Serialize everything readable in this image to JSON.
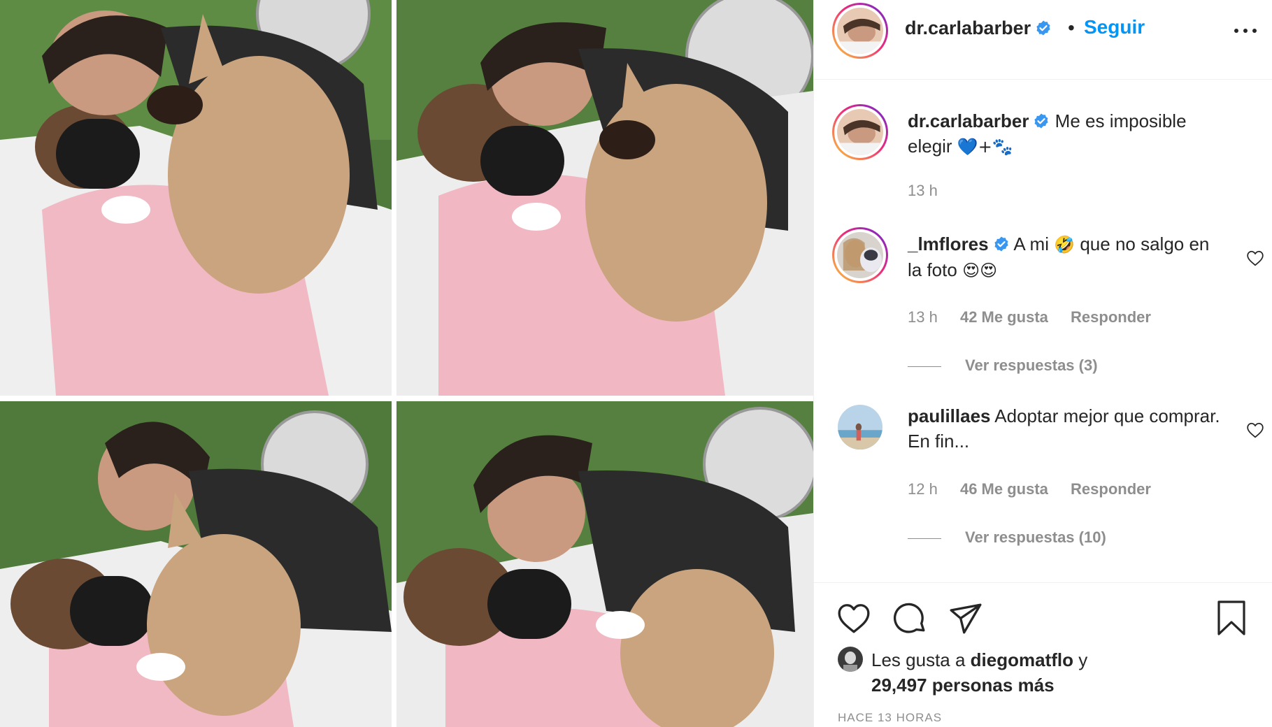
{
  "post": {
    "author": "dr.carlabarber",
    "follow_label": "Seguir",
    "separator": "•",
    "caption": {
      "username": "dr.carlabarber",
      "text": "Me es imposible elegir",
      "emoji": "💙+🐾",
      "time": "13 h"
    },
    "comments": [
      {
        "username": "_lmflores",
        "text": "A mi",
        "emoji_mid": "🤣",
        "text_after": "que no salgo en la foto",
        "emoji_end": "😍😍",
        "time": "13 h",
        "likes": "42 Me gusta",
        "reply_label": "Responder",
        "view_replies": "Ver respuestas (3)"
      },
      {
        "username": "paulillaes",
        "text": "Adoptar mejor que comprar. En fin...",
        "time": "12 h",
        "likes": "46 Me gusta",
        "reply_label": "Responder",
        "view_replies": "Ver respuestas (10)"
      }
    ],
    "likes_prefix": "Les gusta a",
    "likes_user": "diegomatflo",
    "likes_and": "y",
    "likes_count": "29,497 personas más",
    "posted_ago": "HACE 13 HORAS"
  },
  "icons": {
    "verified": "verified-badge-icon",
    "more": "more-options-icon",
    "heart": "heart-icon",
    "comment": "comment-icon",
    "share": "share-icon",
    "save": "bookmark-icon"
  },
  "colors": {
    "link_blue": "#0095f6",
    "text": "#262626",
    "muted": "#8e8e8e",
    "border": "#efefef"
  }
}
